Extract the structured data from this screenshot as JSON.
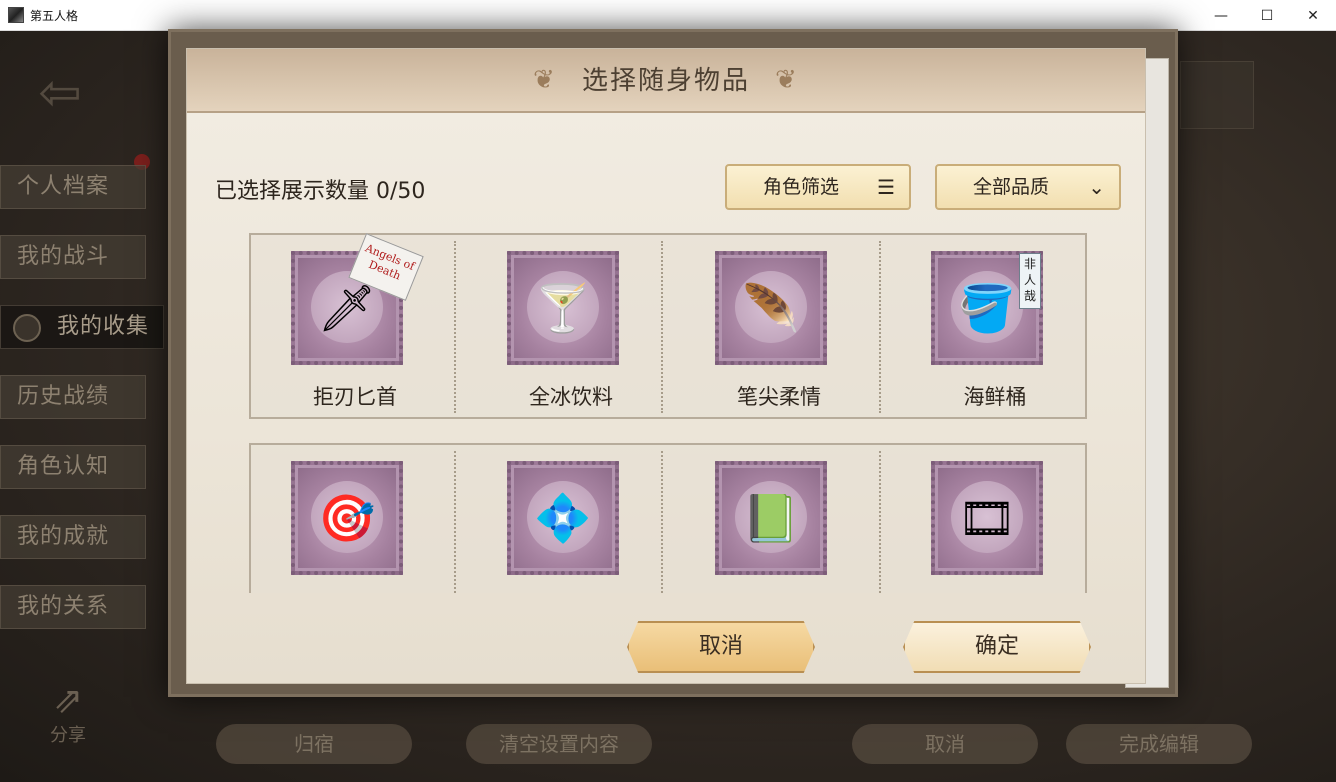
{
  "window": {
    "title": "第五人格",
    "minimize": "—",
    "maximize": "☐",
    "close": "✕"
  },
  "sidebar": {
    "items": [
      {
        "label": "个人档案",
        "active": false
      },
      {
        "label": "我的战斗",
        "active": false
      },
      {
        "label": "我的收集",
        "active": true
      },
      {
        "label": "历史战绩",
        "active": false
      },
      {
        "label": "角色认知",
        "active": false
      },
      {
        "label": "我的成就",
        "active": false
      },
      {
        "label": "我的关系",
        "active": false
      }
    ],
    "share_label": "分享"
  },
  "background_bar": {
    "home": "归宿",
    "clear": "清空设置内容",
    "cancel": "取消",
    "finish": "完成编辑"
  },
  "modal": {
    "title": "选择随身物品",
    "selected_label": "已选择展示数量",
    "selected_count": "0/50",
    "role_filter": "角色筛选",
    "quality_filter": "全部品质",
    "items": [
      {
        "name": "拒刃匕首",
        "icon": "knife-icon",
        "tag": "Angels of Death"
      },
      {
        "name": "全冰饮料",
        "icon": "ice-drink-icon"
      },
      {
        "name": "笔尖柔情",
        "icon": "quill-pen-icon"
      },
      {
        "name": "海鲜桶",
        "icon": "seafood-bucket-icon",
        "tag": "非人哉"
      },
      {
        "name": "",
        "icon": "target-icon"
      },
      {
        "name": "",
        "icon": "crystal-plate-icon"
      },
      {
        "name": "",
        "icon": "green-book-icon"
      },
      {
        "name": "",
        "icon": "film-reel-icon"
      }
    ],
    "cancel": "取消",
    "confirm": "确定"
  }
}
